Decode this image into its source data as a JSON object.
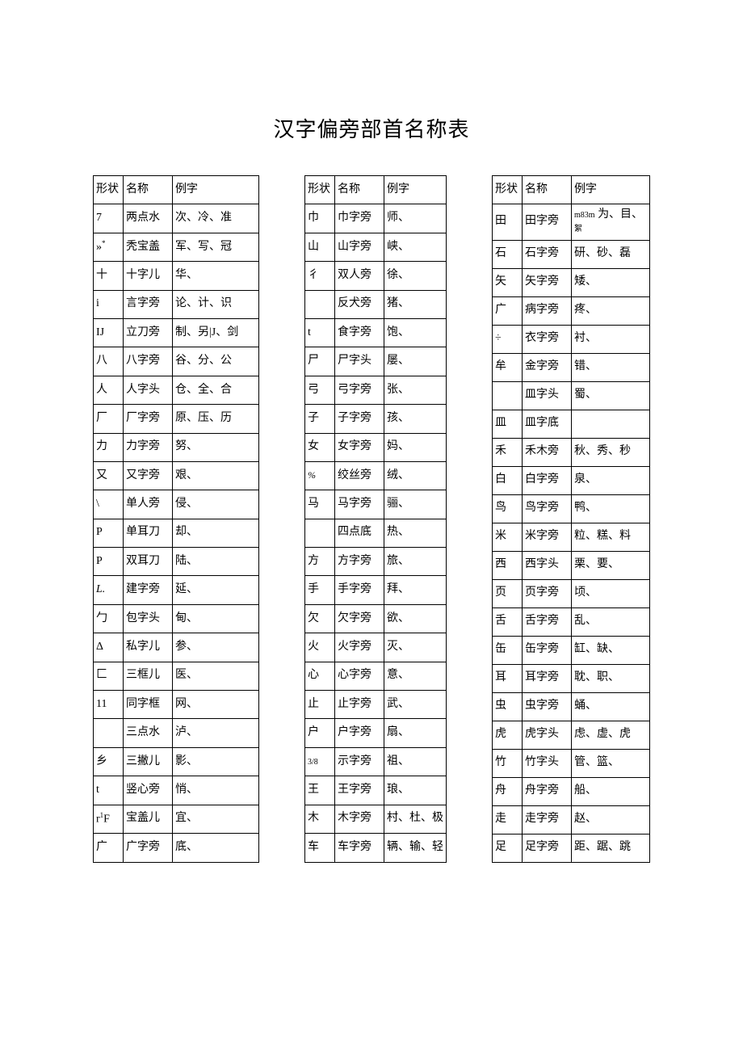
{
  "title": "汉字偏旁部首名称表",
  "header": {
    "shape": "形状",
    "name": "名称",
    "example": "例字"
  },
  "table1": [
    {
      "shape": "7",
      "name": "两点水",
      "ex": "次、冷、准"
    },
    {
      "shape": "»*",
      "name": "秃宝盖",
      "ex": "军、写、冠"
    },
    {
      "shape": "十",
      "name": "十字儿",
      "ex": "华、"
    },
    {
      "shape": "i",
      "name": "言字旁",
      "ex": "论、计、识"
    },
    {
      "shape": "IJ",
      "name": "立刀旁",
      "ex": "制、另|J、剑"
    },
    {
      "shape": "八",
      "name": "八字旁",
      "ex": "谷、分、公"
    },
    {
      "shape": "人",
      "name": "人字头",
      "ex": "仓、全、合"
    },
    {
      "shape": "厂",
      "name": "厂字旁",
      "ex": "原、压、历"
    },
    {
      "shape": "力",
      "name": "力字旁",
      "ex": "努、"
    },
    {
      "shape": "又",
      "name": "又字旁",
      "ex": "艰、"
    },
    {
      "shape": "\\",
      "name": "单人旁",
      "ex": "侵、"
    },
    {
      "shape": "P",
      "name": "单耳刀",
      "ex": "却、"
    },
    {
      "shape": "P",
      "name": "双耳刀",
      "ex": "陆、"
    },
    {
      "shape": "L.",
      "name": "建字旁",
      "ex": "延、"
    },
    {
      "shape": "勹",
      "name": "包字头",
      "ex": "甸、"
    },
    {
      "shape": "Δ",
      "name": "私字儿",
      "ex": "参、"
    },
    {
      "shape": "匚",
      "name": "三框儿",
      "ex": "医、"
    },
    {
      "shape": "11",
      "name": "同字框",
      "ex": "网、"
    },
    {
      "shape": "",
      "name": "三点水",
      "ex": "泸、"
    },
    {
      "shape": "乡",
      "name": "三撇儿",
      "ex": "影、"
    },
    {
      "shape": "t",
      "name": "竖心旁",
      "ex": "悄、"
    },
    {
      "shape": "r¹F",
      "name": "宝盖儿",
      "ex": "宜、"
    },
    {
      "shape": "广",
      "name": "广字旁",
      "ex": "底、"
    }
  ],
  "table2": [
    {
      "shape": "巾",
      "name": "巾字旁",
      "ex": "师、"
    },
    {
      "shape": "山",
      "name": "山字旁",
      "ex": "峡、"
    },
    {
      "shape": "彳",
      "name": "双人旁",
      "ex": "徐、"
    },
    {
      "shape": "",
      "name": "反犬旁",
      "ex": "猪、"
    },
    {
      "shape": "t",
      "name": "食字旁",
      "ex": "饱、"
    },
    {
      "shape": "尸",
      "name": "尸字头",
      "ex": "屡、"
    },
    {
      "shape": "弓",
      "name": "弓字旁",
      "ex": "张、"
    },
    {
      "shape": "子",
      "name": "子字旁",
      "ex": "孩、"
    },
    {
      "shape": "女",
      "name": "女字旁",
      "ex": "妈、"
    },
    {
      "shape": "%",
      "name": "绞丝旁",
      "ex": "绒、"
    },
    {
      "shape": "马",
      "name": "马字旁",
      "ex": "骊、"
    },
    {
      "shape": "",
      "name": "四点底",
      "ex": "热、"
    },
    {
      "shape": "方",
      "name": "方字旁",
      "ex": "旅、"
    },
    {
      "shape": "手",
      "name": "手字旁",
      "ex": "拜、"
    },
    {
      "shape": "欠",
      "name": "欠字旁",
      "ex": "欲、"
    },
    {
      "shape": "火",
      "name": "火字旁",
      "ex": "灭、"
    },
    {
      "shape": "心",
      "name": "心字旁",
      "ex": "意、"
    },
    {
      "shape": "止",
      "name": "止字旁",
      "ex": "武、"
    },
    {
      "shape": "户",
      "name": "户字旁",
      "ex": "扇、"
    },
    {
      "shape": "3/8",
      "name": "示字旁",
      "ex": "祖、"
    },
    {
      "shape": "王",
      "name": "王字旁",
      "ex": "琅、"
    },
    {
      "shape": "木",
      "name": "木字旁",
      "ex": "村、杜、极"
    },
    {
      "shape": "车",
      "name": "车字旁",
      "ex": "辆、输、轻"
    }
  ],
  "table3": [
    {
      "shape": "田",
      "name": "田字旁",
      "ex": "m83m 为、目、絮"
    },
    {
      "shape": "石",
      "name": "石字旁",
      "ex": "研、砂、磊"
    },
    {
      "shape": "矢",
      "name": "矢字旁",
      "ex": "矮、"
    },
    {
      "shape": "广",
      "name": "病字旁",
      "ex": "疼、"
    },
    {
      "shape": "÷",
      "name": "衣字旁",
      "ex": "衬、"
    },
    {
      "shape": "牟",
      "name": "金字旁",
      "ex": "错、"
    },
    {
      "shape": "",
      "name": "皿字头",
      "ex": "蜀、"
    },
    {
      "shape": "皿",
      "name": "皿字底",
      "ex": ""
    },
    {
      "shape": "禾",
      "name": "禾木旁",
      "ex": "秋、秀、秒"
    },
    {
      "shape": "白",
      "name": "白字旁",
      "ex": "泉、"
    },
    {
      "shape": "鸟",
      "name": "鸟字旁",
      "ex": "鸭、"
    },
    {
      "shape": "米",
      "name": "米字旁",
      "ex": "粒、糕、料"
    },
    {
      "shape": "西",
      "name": "西字头",
      "ex": "栗、要、"
    },
    {
      "shape": "页",
      "name": "页字旁",
      "ex": "顷、"
    },
    {
      "shape": "舌",
      "name": "舌字旁",
      "ex": "乱、"
    },
    {
      "shape": "缶",
      "name": "缶字旁",
      "ex": "缸、缺、"
    },
    {
      "shape": "耳",
      "name": "耳字旁",
      "ex": "耽、职、"
    },
    {
      "shape": "虫",
      "name": "虫字旁",
      "ex": "蛹、"
    },
    {
      "shape": "虎",
      "name": "虎字头",
      "ex": "虑、虚、虎"
    },
    {
      "shape": "竹",
      "name": "竹字头",
      "ex": "管、篮、"
    },
    {
      "shape": "舟",
      "name": "舟字旁",
      "ex": "船、"
    },
    {
      "shape": "走",
      "name": "走字旁",
      "ex": "赵、"
    },
    {
      "shape": "足",
      "name": "足字旁",
      "ex": "距、踞、跳"
    }
  ]
}
